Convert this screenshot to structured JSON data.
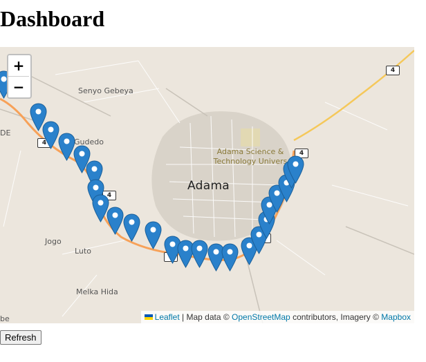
{
  "page": {
    "title": "Dashboard"
  },
  "map": {
    "zoom_in_label": "+",
    "zoom_out_label": "−",
    "place_labels": [
      "Senyo Gebeya",
      "Gudedo",
      "Jogo",
      "Luto",
      "Melka Hida",
      "DE",
      "be"
    ],
    "city_label": "Adama",
    "university_label_line1": "Adama Science &",
    "university_label_line2": "Technology Univers",
    "road_shield": "4",
    "marker_color": "#2a81cb",
    "route_color": "#f7a158",
    "attribution": {
      "leaflet": "Leaflet",
      "sep1": " | Map data © ",
      "osm": "OpenStreetMap",
      "sep2": " contributors, Imagery © ",
      "mapbox": "Mapbox"
    }
  },
  "controls": {
    "refresh_label": "Refresh"
  }
}
